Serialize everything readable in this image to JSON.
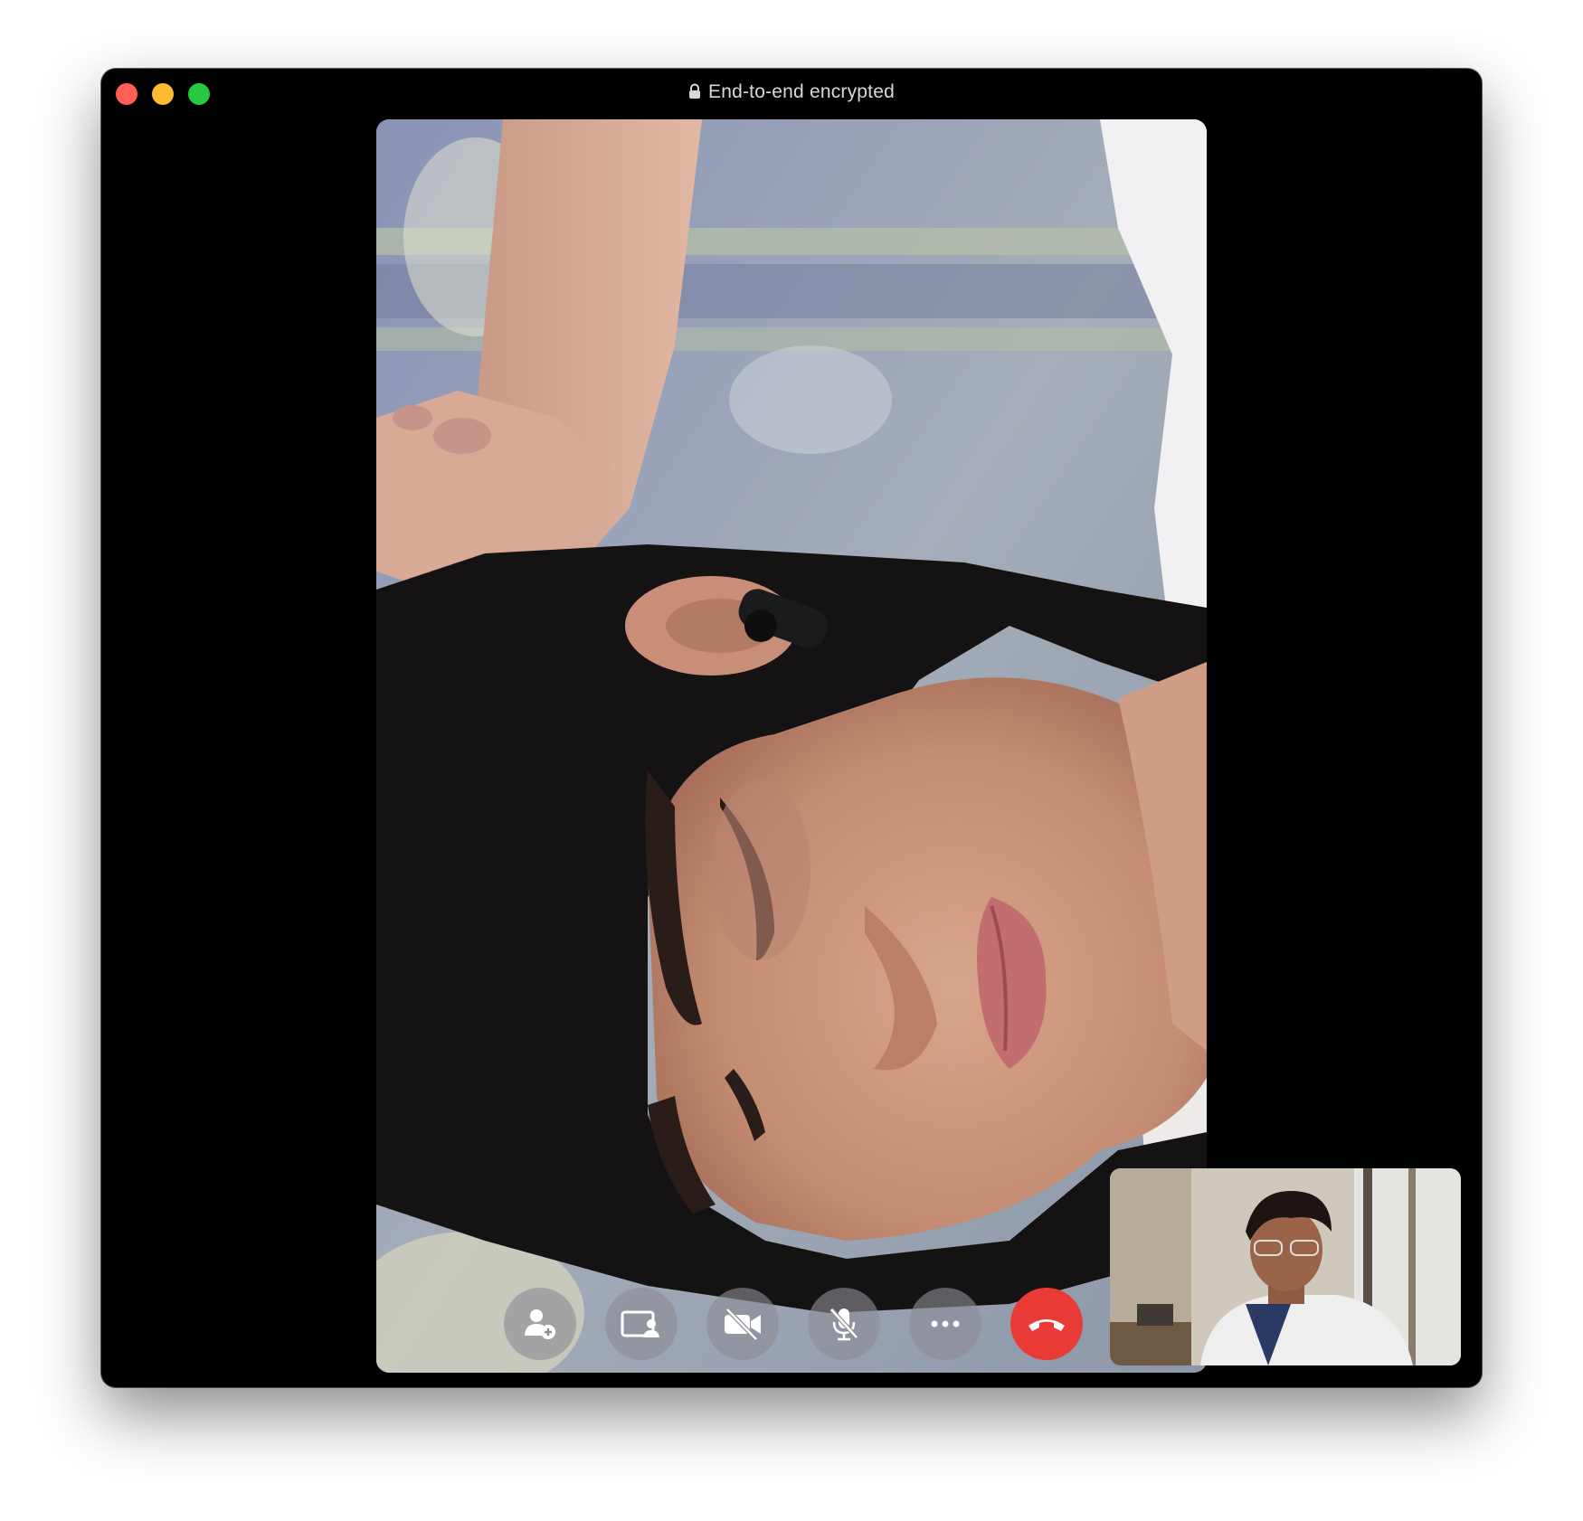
{
  "window": {
    "title": "End-to-end encrypted",
    "title_icon": "lock-icon"
  },
  "traffic_lights": {
    "close_color": "#ff5f57",
    "minimize_color": "#febc2e",
    "maximize_color": "#28c840"
  },
  "controls": [
    {
      "name": "add-participant-button",
      "icon": "person-add-icon"
    },
    {
      "name": "share-screen-button",
      "icon": "screen-share-icon"
    },
    {
      "name": "camera-off-button",
      "icon": "video-off-icon"
    },
    {
      "name": "mute-button",
      "icon": "mic-off-icon"
    },
    {
      "name": "more-options-button",
      "icon": "ellipsis-icon"
    },
    {
      "name": "end-call-button",
      "icon": "phone-hangup-icon",
      "color": "#ea3a35"
    }
  ]
}
